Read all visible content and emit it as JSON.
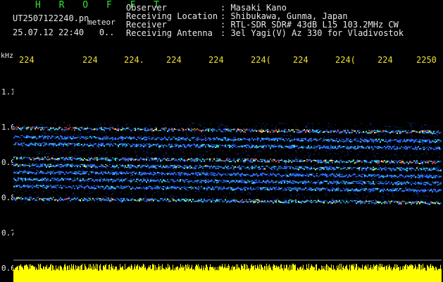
{
  "header": {
    "brand": "H R O F F T",
    "filename": "UT2507122240.pn",
    "tag": "meteor",
    "timestamp": "25.07.12 22:40   0..",
    "fields": [
      {
        "label": "Observer",
        "value": ": Masaki Kano"
      },
      {
        "label": "Receiving Location",
        "value": ": Shibukawa, Gunma, Japan"
      },
      {
        "label": "Receiver",
        "value": ": RTL-SDR SDR# 43dB L15 103.2MHz CW"
      },
      {
        "label": "Receiving Antenna",
        "value": ": 3el Yagi(V) Az 330 for Vladivostok"
      }
    ]
  },
  "x_ticks": [
    "224",
    "224",
    "224.",
    "224",
    "224",
    "224(",
    "224",
    "224(",
    "224",
    "2250"
  ],
  "y_axis": {
    "unit": "kHz",
    "ticks": [
      "1.1",
      "1.0",
      "0.9",
      "0.8",
      "0.7",
      "0.6"
    ]
  },
  "spectrogram": {
    "background": "#000000",
    "noise_color": "#1f3fb8",
    "signal_colors": [
      "#2d6bff",
      "#34e0e0",
      "#f5e34b",
      "#ff4a2a"
    ],
    "amplitude_bar_color": "#ffff00",
    "baseline_color": "#a0a0a0",
    "band_frequencies_khz": [
      1.0,
      0.975,
      0.955,
      0.915,
      0.895,
      0.875,
      0.855,
      0.835,
      0.8
    ]
  }
}
